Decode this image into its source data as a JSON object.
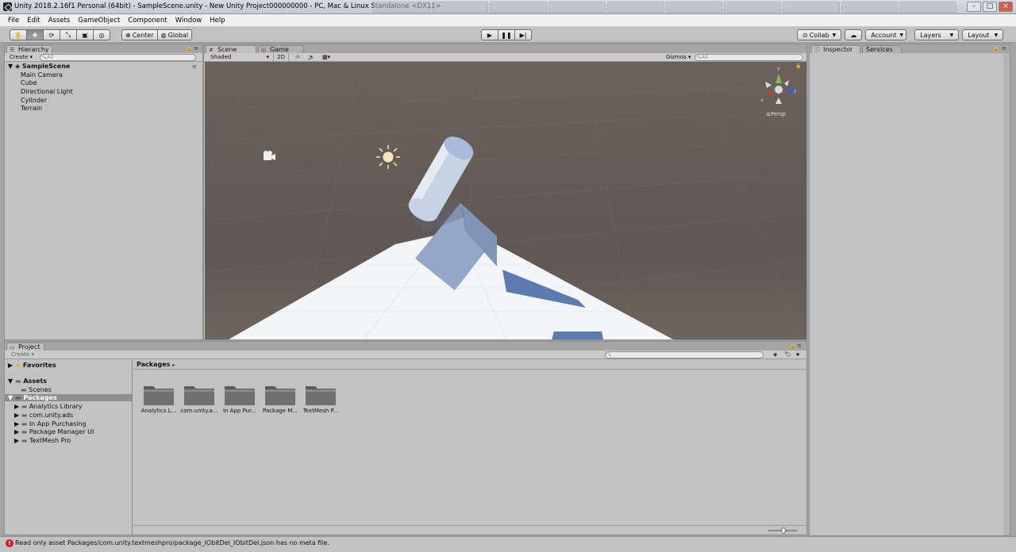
{
  "window": {
    "title": "Unity 2018.2.16f1 Personal (64bit) - SampleScene.unity - New Unity Project000000000 - PC, Mac & Linux Standalone <DX11>"
  },
  "menu": [
    "File",
    "Edit",
    "Assets",
    "GameObject",
    "Component",
    "Window",
    "Help"
  ],
  "toolbar": {
    "pivot_label": "Center",
    "space_label": "Global",
    "collab_label": "Collab",
    "account_label": "Account",
    "layers_label": "Layers",
    "layout_label": "Layout"
  },
  "hierarchy": {
    "tab": "Hierarchy",
    "create_label": "Create",
    "search_placeholder": "All",
    "scene_name": "SampleScene",
    "items": [
      "Main Camera",
      "Cube",
      "Directional Light",
      "Cylinder",
      "Terrain"
    ]
  },
  "scene": {
    "tab_scene": "Scene",
    "tab_game": "Game",
    "shading_mode": "Shaded",
    "mode_2d": "2D",
    "gizmos_label": "Gizmos",
    "search_placeholder": "All",
    "projection_label": "Persp",
    "axis_labels": {
      "y": "y",
      "x": "x",
      "z": "z"
    }
  },
  "inspector": {
    "tab_inspector": "Inspector",
    "tab_services": "Services"
  },
  "project": {
    "tab": "Project",
    "create_label": "Create",
    "breadcrumb": "Packages",
    "tree": [
      {
        "label": "Favorites",
        "bold": true
      },
      {
        "label": "Assets",
        "bold": true
      },
      {
        "label": "Scenes",
        "bold": false
      },
      {
        "label": "Packages",
        "bold": true
      },
      {
        "label": "Analytics Library",
        "bold": false
      },
      {
        "label": "com.unity.ads",
        "bold": false
      },
      {
        "label": "In App Purchasing",
        "bold": false
      },
      {
        "label": "Package Manager UI",
        "bold": false
      },
      {
        "label": "TextMesh Pro",
        "bold": false
      }
    ],
    "folders": [
      "Analytics L...",
      "com.unity.a...",
      "In App Pur...",
      "Package M...",
      "TextMesh P..."
    ]
  },
  "status": {
    "message": "Read only asset Packages/com.unity.textmeshpro/package_IObitDel_IObitDel.json has no meta file."
  },
  "colors": {
    "editor_bg": "#c2c2c2",
    "scene_bg": "#635b55",
    "selection": "#8e8e8e",
    "error": "#d02020"
  }
}
